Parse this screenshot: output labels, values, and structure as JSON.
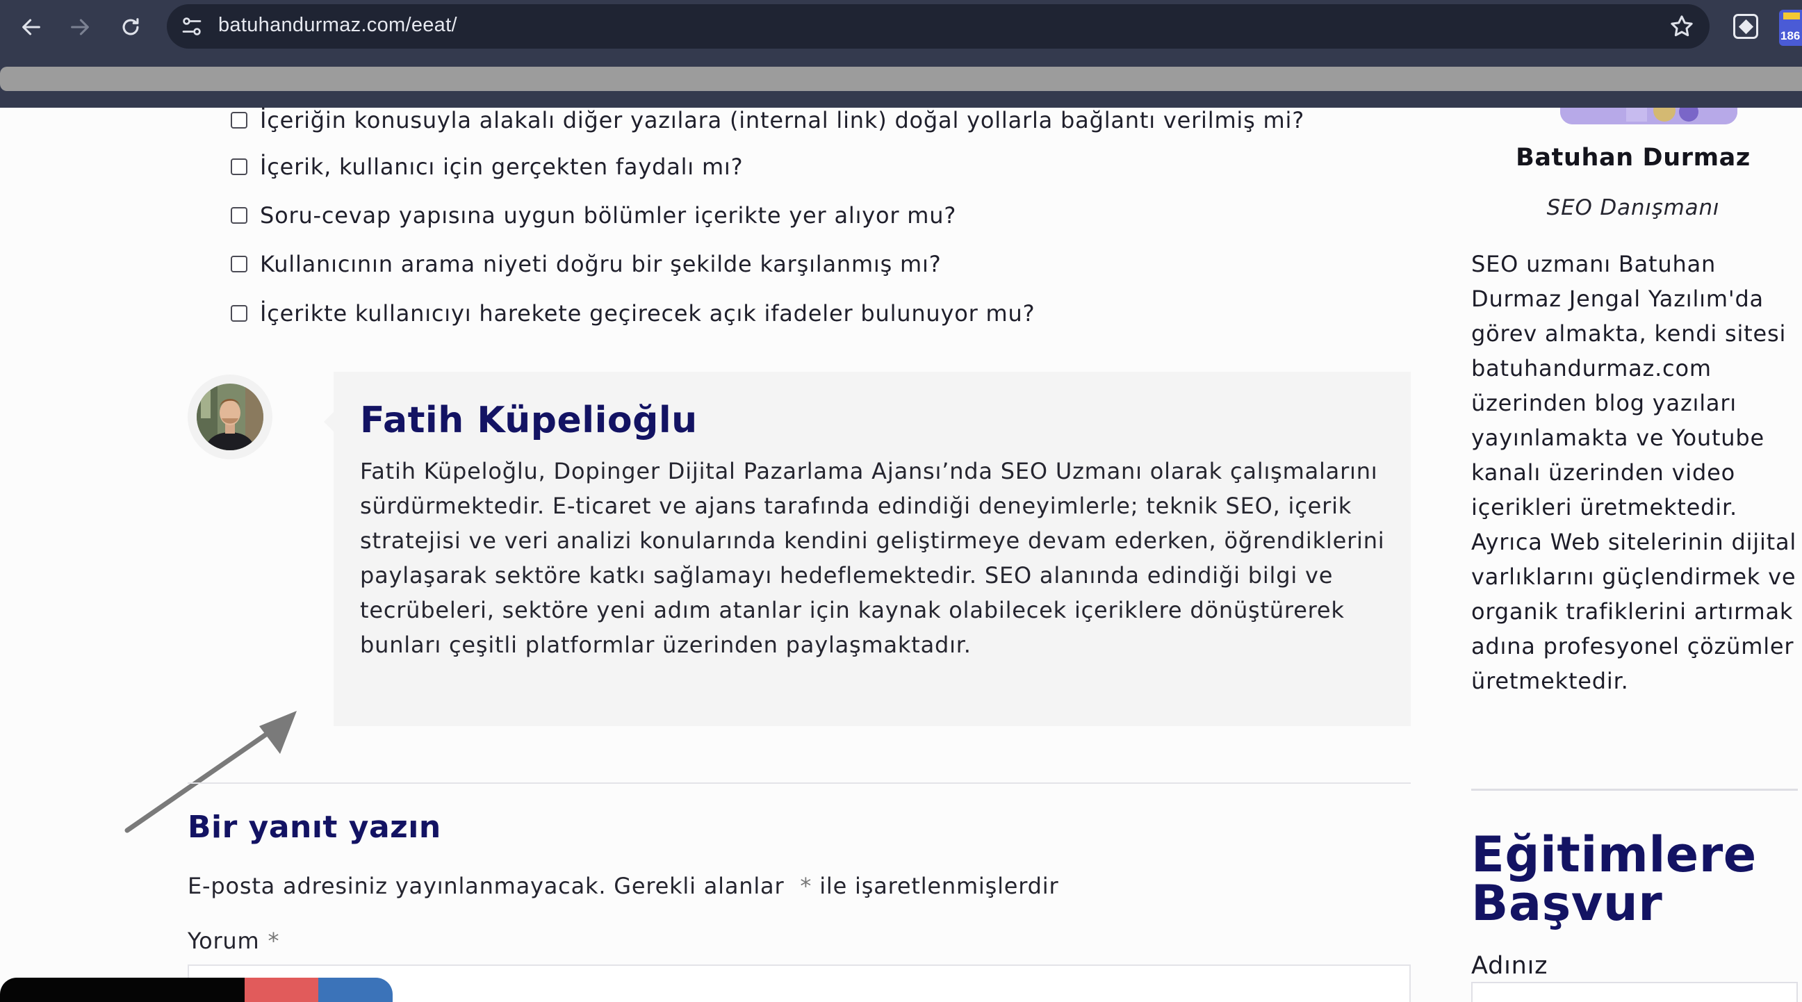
{
  "browser": {
    "url": "batuhandurmaz.com/eeat/",
    "extension_badge": "186",
    "icons": [
      "back-icon",
      "forward-icon",
      "reload-icon",
      "site-info-icon",
      "star-icon",
      "extension-icon"
    ]
  },
  "checklist": {
    "items": [
      "İçeriğin konusuyla alakalı diğer yazılara (internal link) doğal yollarla bağlantı verilmiş mi?",
      "İçerik, kullanıcı için gerçekten faydalı mı?",
      "Soru-cevap yapısına uygun bölümler içerikte yer alıyor mu?",
      "Kullanıcının arama niyeti doğru bir şekilde karşılanmış mı?",
      "İçerikte kullanıcıyı harekete geçirecek açık ifadeler bulunuyor mu?"
    ]
  },
  "author": {
    "name": "Fatih Küpelioğlu",
    "bio": "Fatih Küpeloğlu, Dopinger Dijital Pazarlama Ajansı’nda SEO Uzmanı olarak çalışmalarını sürdürmektedir. E-ticaret ve ajans tarafında edindiği deneyimlerle; teknik SEO, içerik stratejisi ve veri analizi konularında kendini geliştirmeye devam ederken, öğrendiklerini paylaşarak sektöre katkı sağlamayı hedeflemektedir. SEO alanında edindiği bilgi ve tecrübeleri, sektöre yeni adım atanlar için kaynak olabilecek içeriklere dönüştürerek bunları çeşitli platformlar üzerinden paylaşmaktadır."
  },
  "reply": {
    "title": "Bir yanıt yazın",
    "note": "E-posta adresiniz yayınlanmayacak. Gerekli alanlar",
    "note_required": "*",
    "note_suffix": "ile işaretlenmişlerdir",
    "comment_label": "Yorum",
    "comment_required": "*"
  },
  "sidebar": {
    "name": "Batuhan Durmaz",
    "role": "SEO Danışmanı",
    "bio": "SEO uzmanı Batuhan Durmaz Jengal Yazılım'da görev almakta, kendi sitesi batuhandurmaz.com üzerinden blog yazıları yayınlamakta ve Youtube kanalı üzerinden video içerikleri üretmektedir. Ayrıca Web sitelerinin dijital varlıklarını güçlendirmek ve organik trafiklerini artırmak adına profesyonel çözümler üretmektedir.",
    "heading": "Eğitimlere Başvur",
    "field_label": "Adınız"
  },
  "colors": {
    "chrome_bg": "#343a4e",
    "omnibox_bg": "#1f2433",
    "accent_navy": "#131363",
    "share_colors": [
      "#050505",
      "#e15b5b",
      "#3b73b9"
    ]
  }
}
